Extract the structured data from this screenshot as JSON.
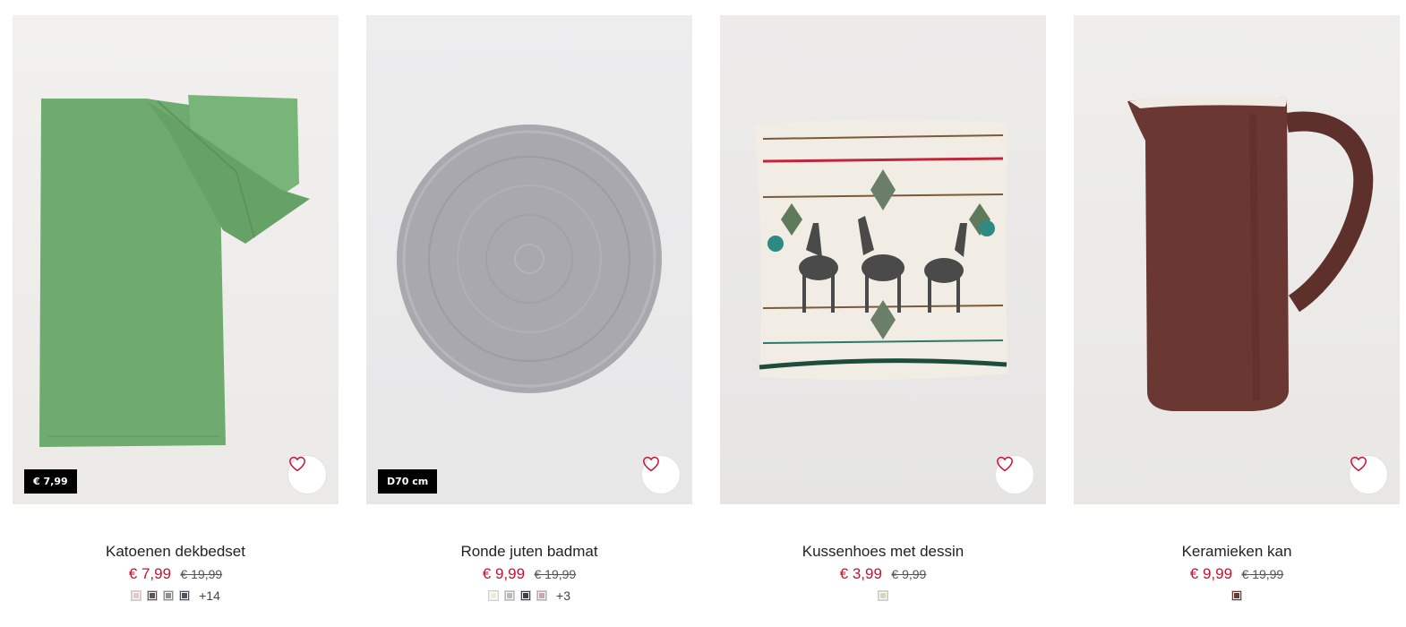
{
  "products": [
    {
      "title": "Katoenen dekbedset",
      "price": "€ 7,99",
      "old_price": "€ 19,99",
      "badge": "€ 7,99",
      "swatches": [
        "#e3c9cc",
        "#5d5558",
        "#8d8f92",
        "#4d5662"
      ],
      "more": "+14"
    },
    {
      "title": "Ronde juten badmat",
      "price": "€ 9,99",
      "old_price": "€ 19,99",
      "badge": "D70 cm",
      "swatches": [
        "#eeecdf",
        "#b9babb",
        "#3f4042",
        "#c6a8ad"
      ],
      "more": "+3"
    },
    {
      "title": "Kussenhoes met dessin",
      "price": "€ 3,99",
      "old_price": "€ 9,99",
      "swatches": [
        "#d6d4c4"
      ]
    },
    {
      "title": "Keramieken kan",
      "price": "€ 9,99",
      "old_price": "€ 19,99",
      "swatches": [
        "#6a3a35"
      ]
    }
  ],
  "colors": {
    "sale_price": "#c8102e",
    "badge_bg": "#000000"
  },
  "icons": {
    "favorite": "heart-outline-icon"
  }
}
